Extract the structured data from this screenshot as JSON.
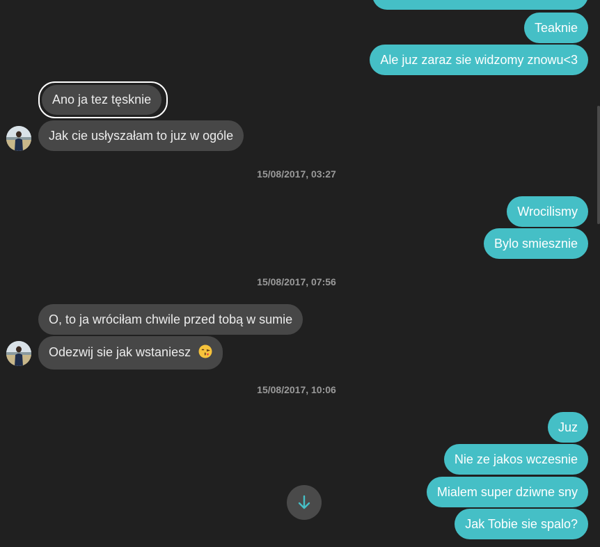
{
  "messages": {
    "out_partial": "",
    "out_teaknie": "Teaknie",
    "out_ale_juz": "Ale juz zaraz sie widzomy znowu<3",
    "in_ano": "Ano ja tez tęsknie",
    "in_jak_cie": "Jak cie usłyszałam to juz w ogóle",
    "out_wrocilismy": "Wrocilismy",
    "out_bylo": "Bylo smiesznie",
    "in_o_to_ja": "O, to ja wróciłam chwile przed tobą w sumie",
    "in_odezwij": "Odezwij sie jak wstaniesz",
    "out_juz": "Juz",
    "out_nie_ze": "Nie ze jakos wczesnie",
    "out_mialem": "Mialem super dziwne sny",
    "out_jak_tobie": "Jak Tobie sie spalo?"
  },
  "timestamps": {
    "t1": "15/08/2017, 03:27",
    "t2": "15/08/2017, 07:56",
    "t3": "15/08/2017, 10:06"
  },
  "icons": {
    "emoji": "kissing-face-emoji",
    "scroll": "arrow-down-icon",
    "avatar": "contact-avatar"
  },
  "colors": {
    "background": "#202020",
    "outgoing_bubble": "#45bfc6",
    "incoming_bubble": "#474747",
    "timestamp": "#9a9a9a"
  }
}
